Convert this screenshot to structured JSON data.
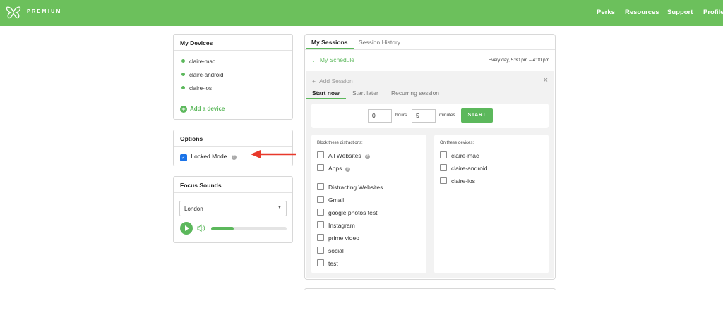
{
  "header": {
    "brand": "PREMIUM",
    "nav": [
      "Perks",
      "Resources",
      "Support",
      "Profile"
    ],
    "bg_color": "#6cc05c"
  },
  "devices_card": {
    "title": "My Devices",
    "devices": [
      "claire-mac",
      "claire-android",
      "claire-ios"
    ],
    "add_label": "Add a device"
  },
  "options_card": {
    "title": "Options",
    "locked_mode_label": "Locked Mode",
    "locked_mode_checked": true
  },
  "sounds_card": {
    "title": "Focus Sounds",
    "selected_sound": "London",
    "volume_fraction": 0.3
  },
  "sessions": {
    "tabs": [
      "My Sessions",
      "Session History"
    ],
    "active_tab": "My Sessions",
    "schedule_label": "My Schedule",
    "schedule_time": "Every day, 5:30 pm – 4:00 pm",
    "add_session_label": "Add Session",
    "sub_tabs": [
      "Start now",
      "Start later",
      "Recurring session"
    ],
    "active_sub_tab": "Start now",
    "hours_value": "0",
    "hours_label": "hours",
    "minutes_value": "5",
    "minutes_label": "minutes",
    "start_label": "START",
    "block_heading": "Block these distractions:",
    "block_top": [
      "All Websites",
      "Apps"
    ],
    "block_lists": [
      "Distracting Websites",
      "Gmail",
      "google photos test",
      "Instagram",
      "prime video",
      "social",
      "test"
    ],
    "devices_heading": "On these devices:",
    "target_devices": [
      "claire-mac",
      "claire-android",
      "claire-ios"
    ]
  },
  "annotation": {
    "arrow_color": "#e8392b"
  }
}
